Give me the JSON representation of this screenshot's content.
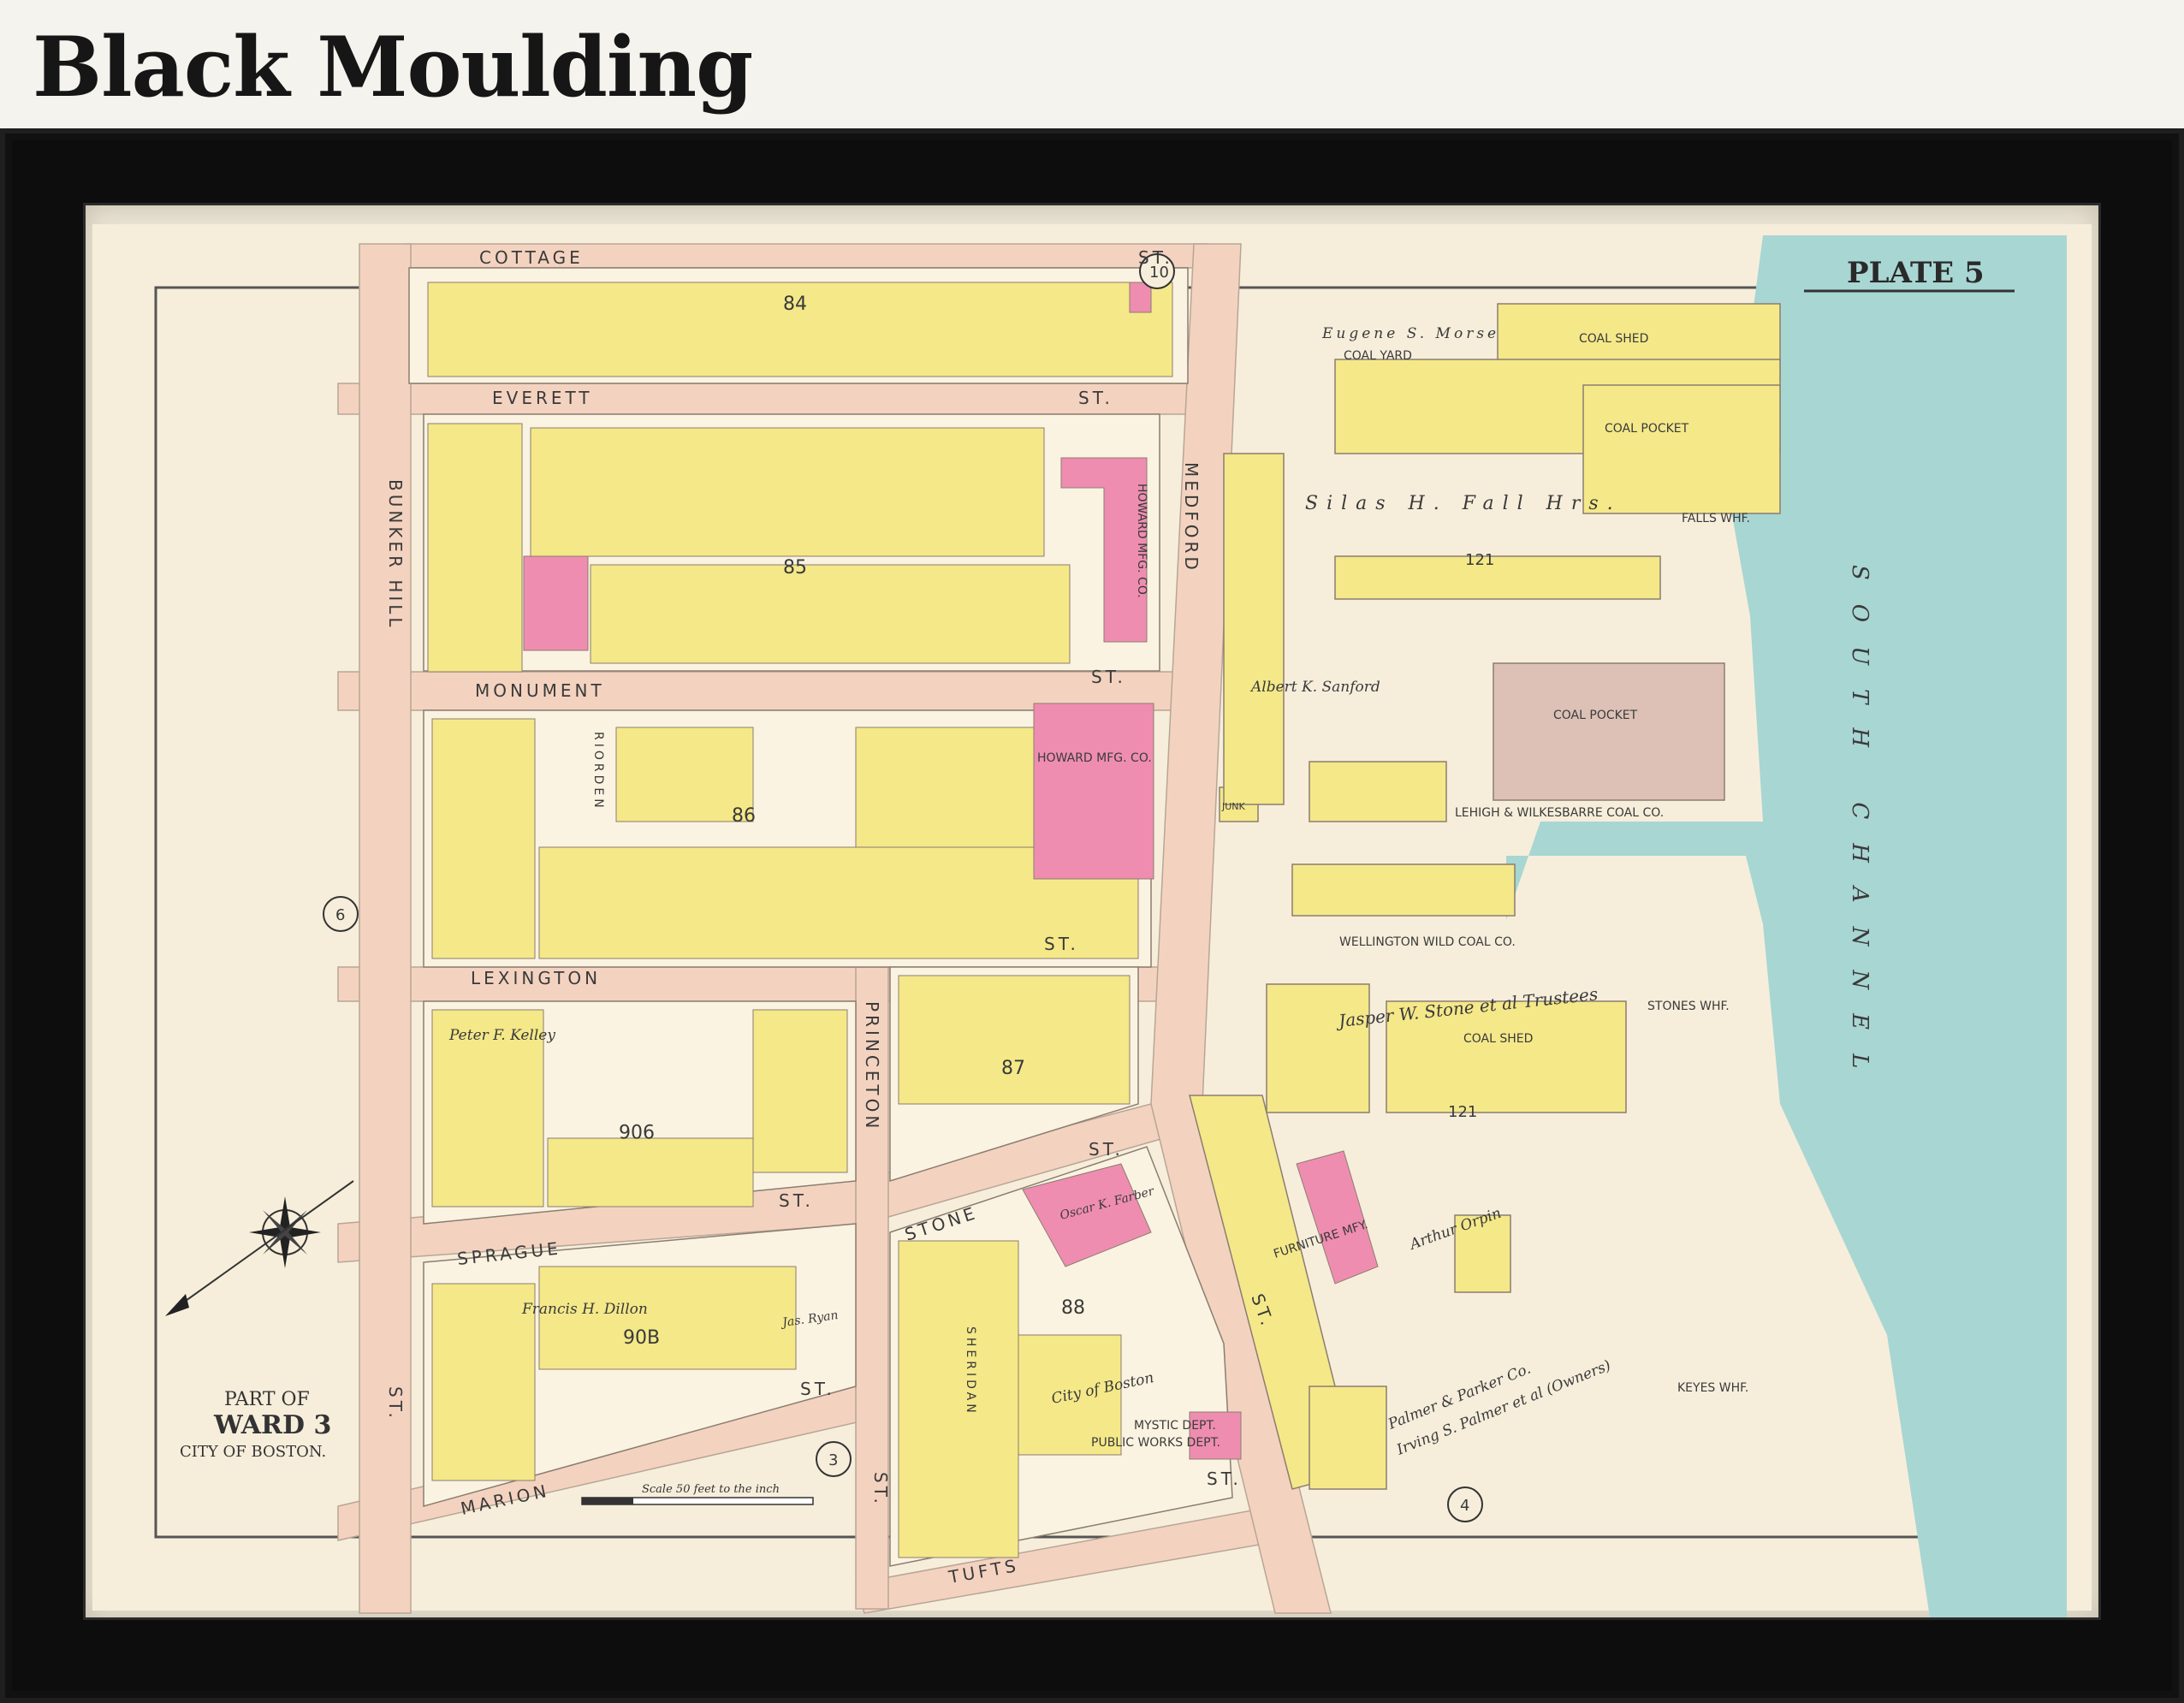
{
  "heading": "Black Moulding",
  "plate": "PLATE 5",
  "ward_block": {
    "line1": "PART OF",
    "line2": "WARD 3",
    "line3": "CITY OF BOSTON."
  },
  "scale_text": "Scale 50 feet to the inch",
  "streets": {
    "cottage": "COTTAGE",
    "everett": "EVERETT",
    "monument": "MONUMENT",
    "lexington": "LEXINGTON",
    "sprague": "SPRAGUE",
    "marion": "MARION",
    "tufts": "TUFTS",
    "bunker_hill": "BUNKER HILL",
    "princeton": "PRINCETON",
    "medford": "MEDFORD",
    "stone": "STONE",
    "sheridan": "SHERIDAN",
    "riorden": "RIORDEN",
    "st": "ST."
  },
  "channel": "SOUTH CHANNEL",
  "buildings": {
    "coal_shed": "COAL SHED",
    "coal_yard": "COAL YARD",
    "coal_pocket": "COAL POCKET",
    "coal_pocket_2": "COAL POCKET",
    "falls_whf": "FALLS WHF.",
    "howard_mfg_1": "HOWARD MFG. CO.",
    "howard_mfg_2": "HOWARD MFG. CO.",
    "lehigh": "LEHIGH & WILKESBARRE COAL CO.",
    "wellington": "WELLINGTON WILD COAL CO.",
    "coal_shed_2": "COAL SHED",
    "stones_whf": "STONES WHF.",
    "furniture": "FURNITURE MFY.",
    "mystic": "MYSTIC DEPT.",
    "public_works": "PUBLIC WORKS DEPT.",
    "keyes_whf": "KEYES WHF.",
    "junk": "JUNK"
  },
  "owners": {
    "eugene_morse": "Eugene S. Morse",
    "silas_fall": "Silas H. Fall Hrs.",
    "albert_sanford": "Albert K. Sanford",
    "jasper_stone": "Jasper W. Stone et al Trustees",
    "arthur_orpin": "Arthur Orpin",
    "palmer_parker": "Palmer & Parker Co.",
    "irving_palmer": "Irving S. Palmer et al (Owners)",
    "oscar_farber": "Oscar K. Farber",
    "peter_kelley": "Peter F. Kelley",
    "francis_dillon": "Francis H. Dillon",
    "jas_ryan": "Jas. Ryan",
    "city_of_boston": "City of Boston"
  },
  "numbers": {
    "n121a": "121",
    "n121b": "121",
    "n84": "84",
    "n85": "85",
    "n86": "86",
    "n87": "87",
    "n88": "88",
    "n90b": "90B",
    "n906": "906"
  },
  "circles": {
    "c10": "10",
    "c6": "6",
    "c3": "3",
    "c4": "4"
  },
  "colors": {
    "paper": "#f6eedb",
    "yellow": "#f4e889",
    "pink": "#ef8db0",
    "water": "#a8d6d3",
    "street": "#f3d3c0",
    "tan": "#ddc1b6",
    "frame": "#0d0d0d"
  }
}
